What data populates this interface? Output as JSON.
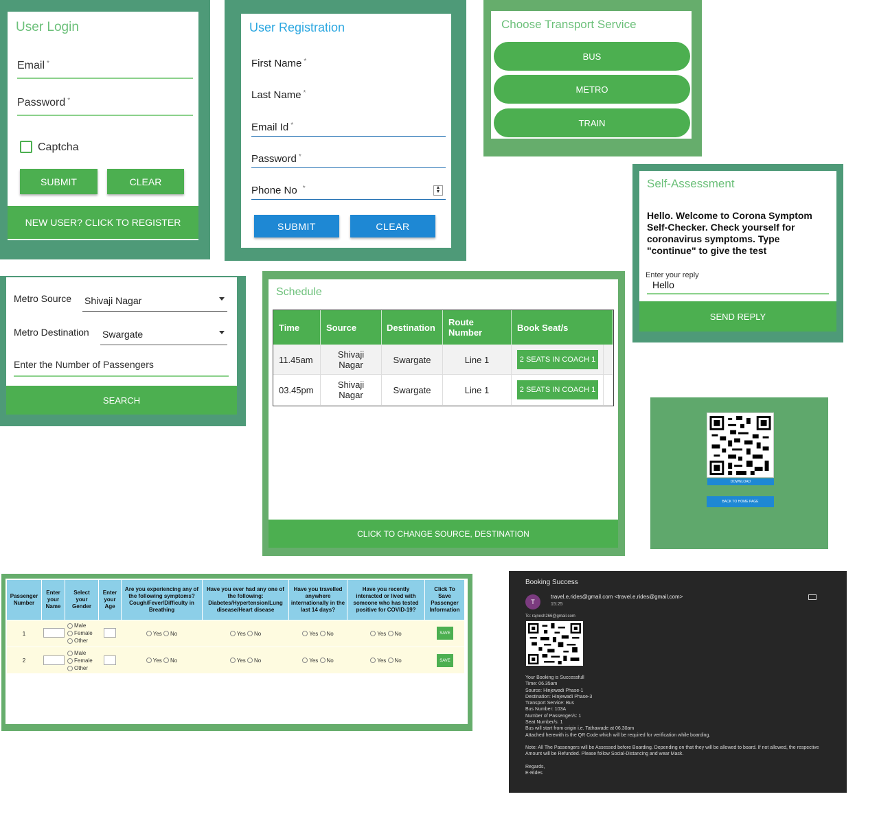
{
  "login": {
    "title": "User Login",
    "email_label": "Email",
    "password_label": "Password",
    "required_mark": "*",
    "captcha_label": "Captcha",
    "submit": "SUBMIT",
    "clear": "CLEAR",
    "register": "NEW USER? CLICK TO REGISTER"
  },
  "registration": {
    "title": "User Registration",
    "first_name": "First Name",
    "last_name": "Last Name",
    "email": "Email Id",
    "password": "Password",
    "phone": "Phone No",
    "required_mark": "*",
    "submit": "SUBMIT",
    "clear": "CLEAR"
  },
  "transport": {
    "title": "Choose Transport Service",
    "options": [
      "BUS",
      "METRO",
      "TRAIN"
    ]
  },
  "assessment": {
    "title": "Self-Assessment",
    "message": "Hello. Welcome to Corona Symptom Self-Checker. Check yourself for coronavirus symptoms. Type \"continue\" to give the test",
    "reply_label": "Enter your reply",
    "reply_value": "Hello",
    "send": "SEND REPLY"
  },
  "metro_search": {
    "source_label": "Metro Source",
    "source_value": "Shivaji Nagar",
    "dest_label": "Metro Destination",
    "dest_value": "Swargate",
    "passengers_placeholder": "Enter the Number of Passengers",
    "search": "SEARCH"
  },
  "schedule": {
    "title": "Schedule",
    "columns": [
      "Time",
      "Source",
      "Destination",
      "Route Number",
      "Book Seat/s"
    ],
    "rows": [
      {
        "time": "11.45am",
        "source": "Shivaji Nagar",
        "destination": "Swargate",
        "route": "Line 1",
        "book": "2 SEATS IN COACH 1"
      },
      {
        "time": "03.45pm",
        "source": "Shivaji Nagar",
        "destination": "Swargate",
        "route": "Line 1",
        "book": "2 SEATS IN COACH 1"
      }
    ],
    "change": "CLICK TO CHANGE SOURCE, DESTINATION"
  },
  "qr_panel": {
    "download": "DOWNLOAD",
    "back": "BACK TO HOME PAGE"
  },
  "passenger_form": {
    "headers": [
      "Passenger Number",
      "Enter your Name",
      "Select your Gender",
      "Enter your Age",
      "Are you experiencing any of the following symptoms? Cough/Fever/Difficulty in Breathing",
      "Have you ever had any one of the following: Diabetes/Hypertension/Lung disease/Heart disease",
      "Have you travelled anywhere internationally in the last 14 days?",
      "Have you recently interacted or lived with someone who has tested positive for COVID-19?",
      "Click To Save Passenger Information"
    ],
    "rows": [
      "1",
      "2"
    ],
    "genders": [
      "Male",
      "Female",
      "Other"
    ],
    "yes": "Yes",
    "no": "No",
    "save": "SAVE"
  },
  "email": {
    "subject": "Booking Success",
    "sender": "travel.e.rides@gmail.com <travel.e.rides@gmail.com>",
    "time": "15:25",
    "avatar": "T",
    "to": "To: rajnesh266@gmail.com",
    "lines": [
      "Your Booking is Successfull",
      "Time: 06.35am",
      "Source: Hinjewadi Phase-1",
      "Destination: Hinjewadi Phase-3",
      "Transport Service: Bus",
      "Bus Number: 103A",
      "Number of Passenger/s: 1",
      "Seat Number/s: 1",
      "Bus will start from origin i.e. Tathawade at 06.30am",
      "Attached herewith is the QR Code which will be required for verification while boarding."
    ],
    "note": "Note: All The Passengers will be Assessed before Boarding. Depending on that they will be allowed to board. If not allowed, the respective Amount will be Refunded. Please follow Social-Distancing and wear Mask.",
    "regards": "Regards,",
    "signature": "E-Rides"
  },
  "colors": {
    "panel_green": "#4e9a78",
    "frame_green": "#66ad6c",
    "button_green": "#4caf50",
    "blue_button": "#1e88d4",
    "header_blue": "#8ccfe8",
    "email_bg": "#262626"
  }
}
